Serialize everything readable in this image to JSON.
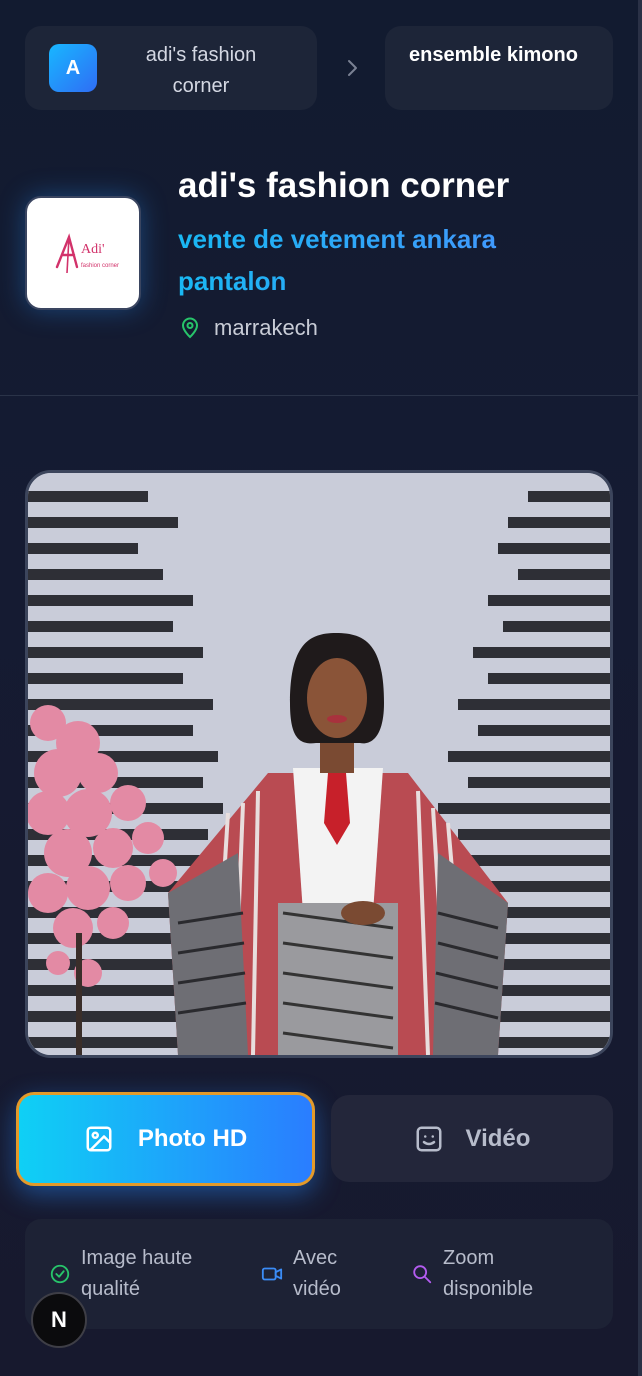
{
  "breadcrumb": {
    "store_initial": "A",
    "store_label": "adi's fashion corner",
    "current_label": "ensemble kimono"
  },
  "store": {
    "name": "adi's fashion corner",
    "tagline": "vente de vetement ankara pantalon",
    "location": "marrakech",
    "logo_text": "Adi'",
    "logo_subtext": "fashion corner"
  },
  "product_photo": {
    "icon": "product-photo"
  },
  "media_tabs": {
    "photo_label": "Photo HD",
    "video_label": "Vidéo",
    "selected": "Photo HD"
  },
  "features": [
    {
      "label": "Image haute qualité",
      "icon": "check-circle-icon",
      "color": "#27c46a"
    },
    {
      "label": "Avec vidéo",
      "icon": "video-icon",
      "color": "#3b8cf6"
    },
    {
      "label": "Zoom disponible",
      "icon": "search-icon",
      "color": "#b35cf0"
    }
  ],
  "next_badge": "N",
  "colors": {
    "accent_start": "#0fd0f5",
    "accent_end": "#2a7dff",
    "selected_border": "#e39a2a",
    "location_icon": "#27c46a"
  }
}
